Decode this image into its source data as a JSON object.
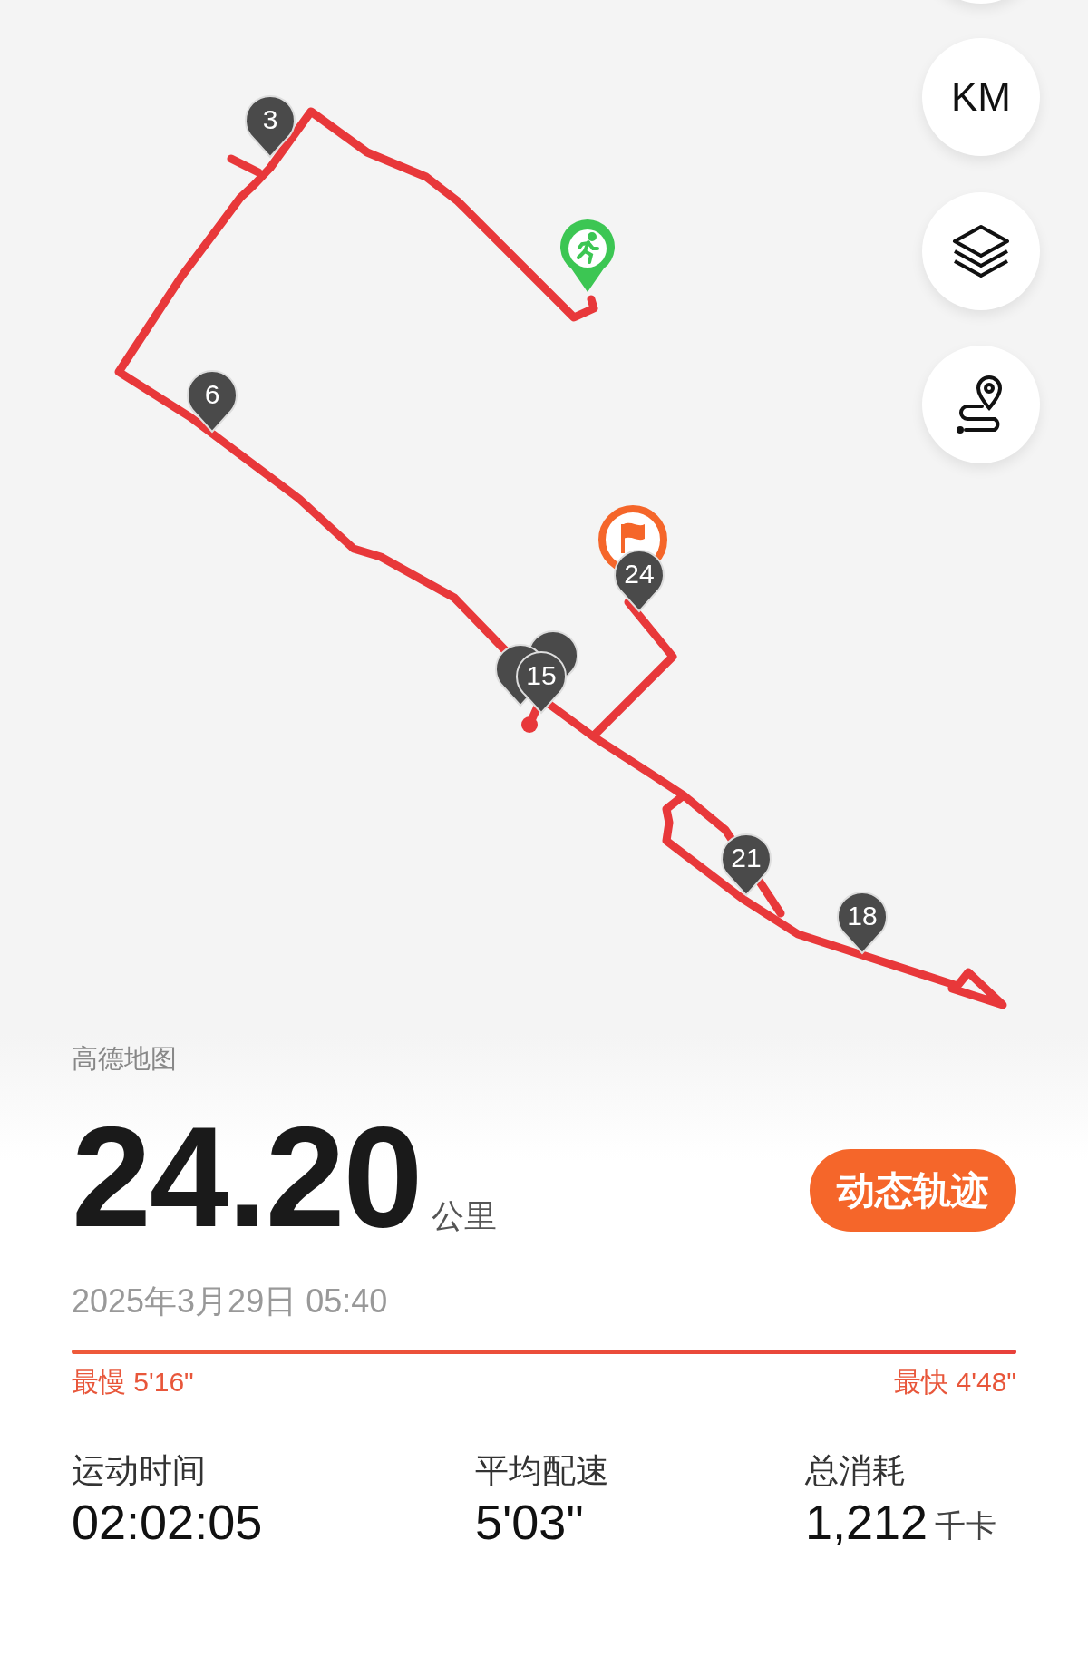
{
  "map": {
    "controls": [
      {
        "kind": "text",
        "label": "KM"
      },
      {
        "kind": "layers"
      },
      {
        "kind": "route"
      }
    ],
    "km_markers": [
      {
        "kind": "labeled",
        "label": "3"
      },
      {
        "kind": "labeled",
        "label": "6"
      },
      {
        "kind": "hidden"
      },
      {
        "kind": "hidden"
      },
      {
        "kind": "labeled",
        "label": "15"
      },
      {
        "kind": "labeled",
        "label": "18"
      },
      {
        "kind": "labeled",
        "label": "21"
      },
      {
        "kind": "labeled",
        "label": "24"
      }
    ],
    "attribution": "高德地图"
  },
  "summary": {
    "distance": "24.20",
    "distance_unit": "公里",
    "button": "动态轨迹",
    "date": "2025年3月29日 05:40"
  },
  "pace": {
    "slowest_label": "最慢",
    "slowest": "5'16\"",
    "fastest_label": "最快",
    "fastest": "4'48\""
  },
  "stats": [
    {
      "label": "运动时间",
      "value": "02:02:05"
    },
    {
      "label": "平均配速",
      "value": "5'03\""
    },
    {
      "label": "总消耗",
      "value": "1,212",
      "unit": "千卡"
    }
  ]
}
